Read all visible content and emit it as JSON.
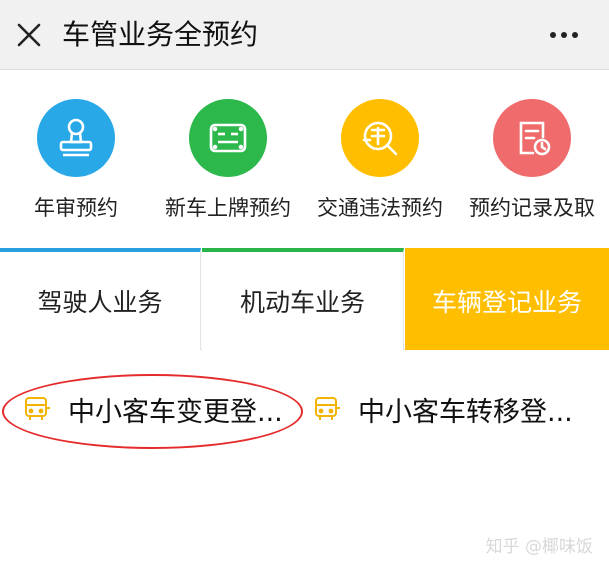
{
  "header": {
    "title": "车管业务全预约",
    "close_icon": "close-icon",
    "more_icon": "more-dots-icon"
  },
  "quick_actions": [
    {
      "label": "年审预约",
      "icon": "stamp-icon",
      "color": "#29a8e8"
    },
    {
      "label": "新车上牌预约",
      "icon": "license-plate-icon",
      "color": "#2cb84a"
    },
    {
      "label": "交通违法预约",
      "icon": "violation-icon",
      "color": "#ffbf00"
    },
    {
      "label": "预约记录及取",
      "icon": "record-clock-icon",
      "color": "#f06b6b"
    }
  ],
  "tabs": [
    {
      "label": "驾驶人业务",
      "accent": "#2aa0e0"
    },
    {
      "label": "机动车业务",
      "accent": "#2ab54a"
    },
    {
      "label": "车辆登记业务",
      "accent": "#ffbf00",
      "selected": true
    }
  ],
  "list_items": [
    {
      "label": "中小客车变更登...",
      "icon": "bus-outline-icon"
    },
    {
      "label": "中小客车转移登...",
      "icon": "bus-outline-icon"
    }
  ],
  "annotation": {
    "color": "#e52b2b"
  },
  "watermark": "知乎 @椰味饭"
}
